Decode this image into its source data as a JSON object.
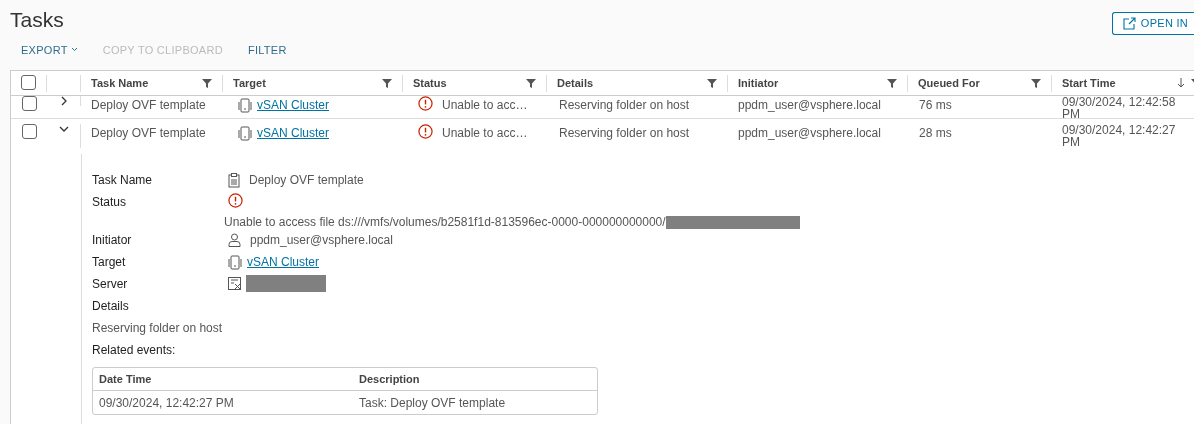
{
  "page": {
    "title": "Tasks",
    "open_button": "OPEN IN"
  },
  "toolbar": [
    {
      "label": "EXPORT",
      "disabled": false,
      "dropdown": true
    },
    {
      "label": "COPY TO CLIPBOARD",
      "disabled": true,
      "dropdown": false
    },
    {
      "label": "FILTER",
      "disabled": false,
      "dropdown": false
    }
  ],
  "table": {
    "select_all": false,
    "columns": [
      {
        "label": "Task Name",
        "sorted": false
      },
      {
        "label": "Target",
        "sorted": false
      },
      {
        "label": "Status",
        "sorted": false
      },
      {
        "label": "Details",
        "sorted": false
      },
      {
        "label": "Initiator",
        "sorted": false
      },
      {
        "label": "Queued For",
        "sorted": false
      },
      {
        "label": "Start Time",
        "sorted": true
      }
    ],
    "rows": [
      {
        "checked": false,
        "expanded": false,
        "task": "Deploy OVF template",
        "target": "vSAN Cluster",
        "status": "Unable to acc…",
        "error": true,
        "details": "Reserving folder on host",
        "initiator": "ppdm_user@vsphere.local",
        "queued": "76 ms",
        "start": [
          "09/30/2024, 12:42:58",
          "PM"
        ]
      },
      {
        "checked": false,
        "expanded": true,
        "task": "Deploy OVF template",
        "target": "vSAN Cluster",
        "status": "Unable to acc…",
        "error": true,
        "details": "Reserving folder on host",
        "initiator": "ppdm_user@vsphere.local",
        "queued": "28 ms",
        "start": [
          "09/30/2024, 12:42:27",
          "PM"
        ]
      }
    ]
  },
  "detail": {
    "fields": [
      {
        "label": "Task Name",
        "kind": "task",
        "value": "Deploy OVF template"
      },
      {
        "label": "Status",
        "kind": "status",
        "value": "Unable to access file ds:///vmfs/volumes/b2581f1d-813596ec-0000-000000000000/"
      },
      {
        "label": "Initiator",
        "kind": "user",
        "value": "ppdm_user@vsphere.local"
      },
      {
        "label": "Target",
        "kind": "link",
        "value": "vSAN Cluster"
      },
      {
        "label": "Server",
        "kind": "server"
      },
      {
        "label": "Details",
        "kind": "heading"
      }
    ],
    "details_text": "Reserving folder on host",
    "related_label": "Related events:",
    "events": {
      "columns": [
        "Date Time",
        "Description"
      ],
      "rows": [
        [
          "09/30/2024, 12:42:27 PM",
          "Task: Deploy OVF template"
        ]
      ]
    }
  }
}
